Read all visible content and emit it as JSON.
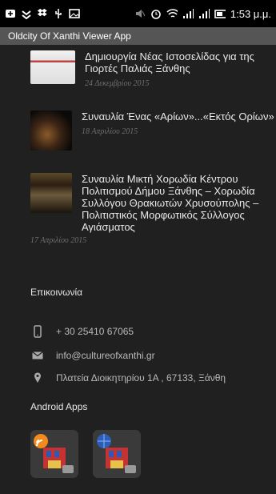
{
  "status": {
    "time": "1:53 μ.μ."
  },
  "app": {
    "title": "Oldcity Of Xanthi Viewer App"
  },
  "posts": [
    {
      "title": "Δημιουργία Νέας Ιστοσελίδας για της Γιορτές Παλιάς Ξάνθης",
      "date": "24 Δεκεμβρίου 2015"
    },
    {
      "title": "Συναυλία Ένας «Αρίων»...«Εκτός Ορίων»",
      "date": "18 Απριλίου 2015"
    },
    {
      "title": "Συναυλία Μικτή Χορωδία Κέντρου Πολιτισμού Δήμου Ξάνθης – Χορωδία Συλλόγου Θρακιωτών Χρυσούπολης – Πολιτιστικός Μορφωτικός Σύλλογος Αγιάσματος",
      "date": "17 Απριλίου 2015"
    }
  ],
  "contact": {
    "title": "Επικοινωνία",
    "phone": "+ 30 25410 67065",
    "email": "info@cultureofxanthi.gr",
    "address": "Πλατεία Διοικητηρίου 1Α , 67133, Ξάνθη"
  },
  "apps_section": {
    "title": "Android Apps"
  },
  "icons": {
    "phone": "phone-icon",
    "email": "envelope-icon",
    "address": "location-pin-icon"
  }
}
